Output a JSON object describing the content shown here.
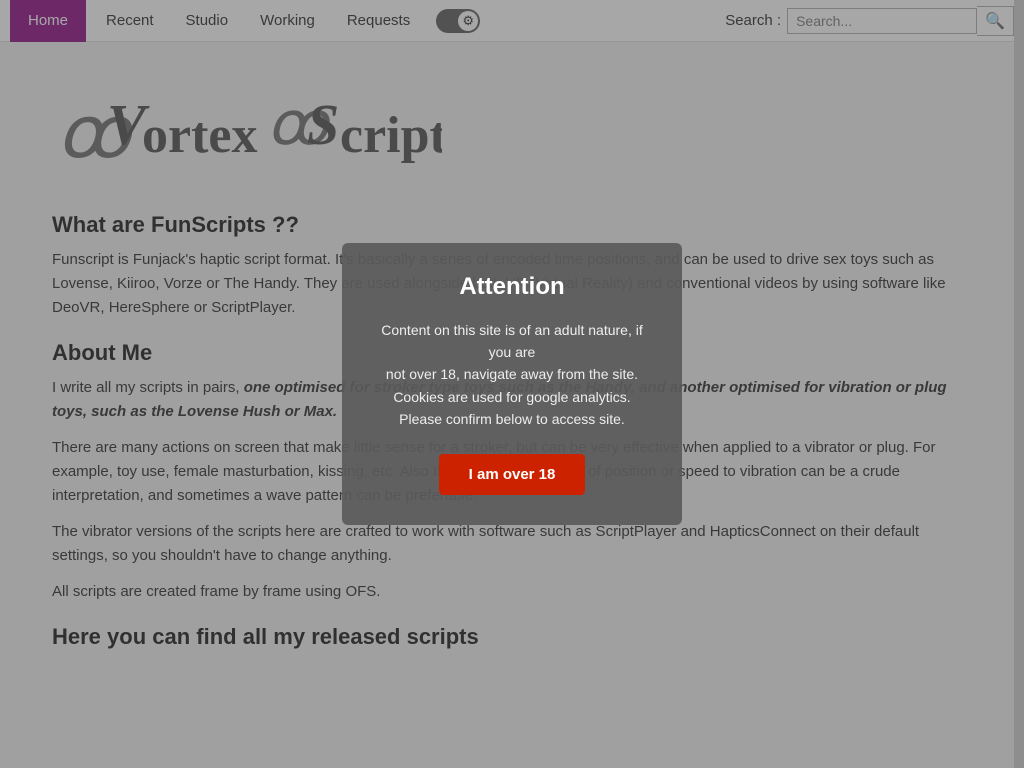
{
  "nav": {
    "home_label": "Home",
    "recent_label": "Recent",
    "studio_label": "Studio",
    "working_label": "Working",
    "requests_label": "Requests"
  },
  "search": {
    "label": "Search :",
    "placeholder": "Search...",
    "button_icon": "🔍"
  },
  "toggle": {
    "icon": "⚙"
  },
  "logo": {
    "text": "Vortex Scriptor"
  },
  "page": {
    "section1_heading": "What are FunScripts ??",
    "section1_para1": "Funscript is Funjack's haptic script format. It's basically a series of encoded time positions, and can be used to drive sex toys such as Lovense, Kiiroo, Vorze or The Handy. They are used alongside both VR (Virtual Reality) and conventional videos by using software like DeoVR, HereSphere or ScriptPlayer.",
    "section2_heading": "About Me",
    "section2_para1_prefix": "I write all my scripts in pairs,",
    "section2_para1_bold": " one optimised for stroker type toys such as the Handy, and another optimised for vibration or plug toys, such as the Lovense Hush or Max.",
    "section2_para2": "There are many actions on screen that make little sense for a stroker, but can be very effective when applied to a vibrator or plug. For example, toy use, female masturbation, kissing, etc. Also the default translations of position or speed to vibration can be a crude interpretation, and sometimes a wave pattern can be preferable.",
    "section2_para3": "The vibrator versions of the scripts here are crafted to work with software such as ScriptPlayer and HapticsConnect on their default settings, so you shouldn't have to change anything.",
    "section2_para4": "All scripts are created frame by frame using OFS.",
    "section3_heading": "Here you can find all my released scripts"
  },
  "modal": {
    "title": "Attention",
    "body_line1": "Content on this site is of an adult nature, if you are",
    "body_line2": "not over 18, navigate away from the site.",
    "body_line3": "Cookies are used for google analytics.",
    "body_line4": "Please confirm below to access site.",
    "confirm_label": "I am over 18"
  }
}
